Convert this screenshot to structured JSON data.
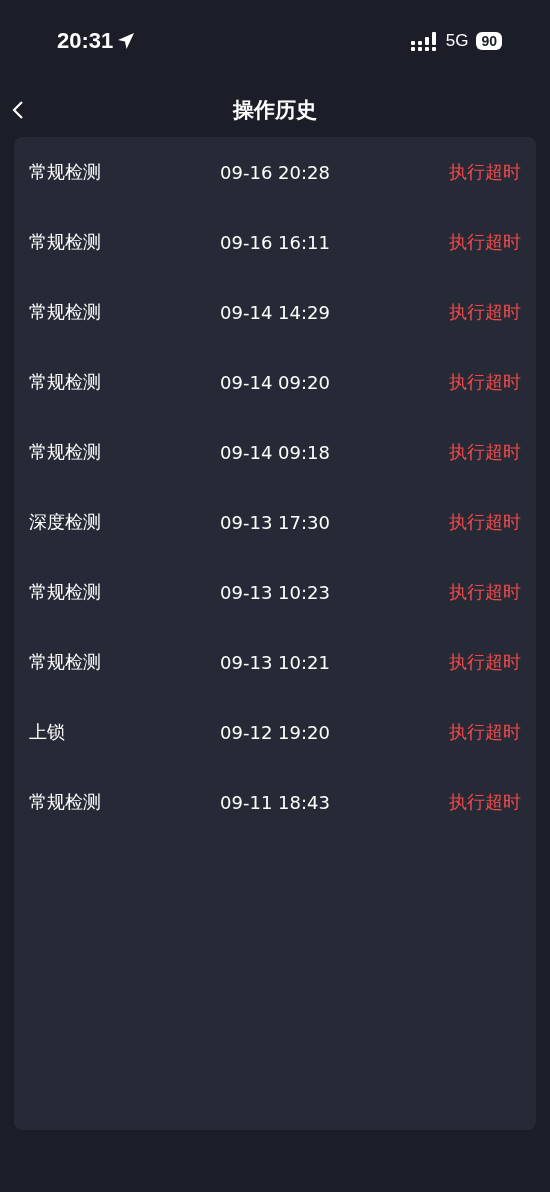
{
  "status_bar": {
    "time": "20:31",
    "network": "5G",
    "battery": "90"
  },
  "header": {
    "title": "操作历史"
  },
  "history": [
    {
      "operation": "常规检测",
      "time": "09-16 20:28",
      "result": "执行超时"
    },
    {
      "operation": "常规检测",
      "time": "09-16 16:11",
      "result": "执行超时"
    },
    {
      "operation": "常规检测",
      "time": "09-14 14:29",
      "result": "执行超时"
    },
    {
      "operation": "常规检测",
      "time": "09-14 09:20",
      "result": "执行超时"
    },
    {
      "operation": "常规检测",
      "time": "09-14 09:18",
      "result": "执行超时"
    },
    {
      "operation": "深度检测",
      "time": "09-13 17:30",
      "result": "执行超时"
    },
    {
      "operation": "常规检测",
      "time": "09-13 10:23",
      "result": "执行超时"
    },
    {
      "operation": "常规检测",
      "time": "09-13 10:21",
      "result": "执行超时"
    },
    {
      "operation": "上锁",
      "time": "09-12 19:20",
      "result": "执行超时"
    },
    {
      "operation": "常规检测",
      "time": "09-11 18:43",
      "result": "执行超时"
    }
  ]
}
